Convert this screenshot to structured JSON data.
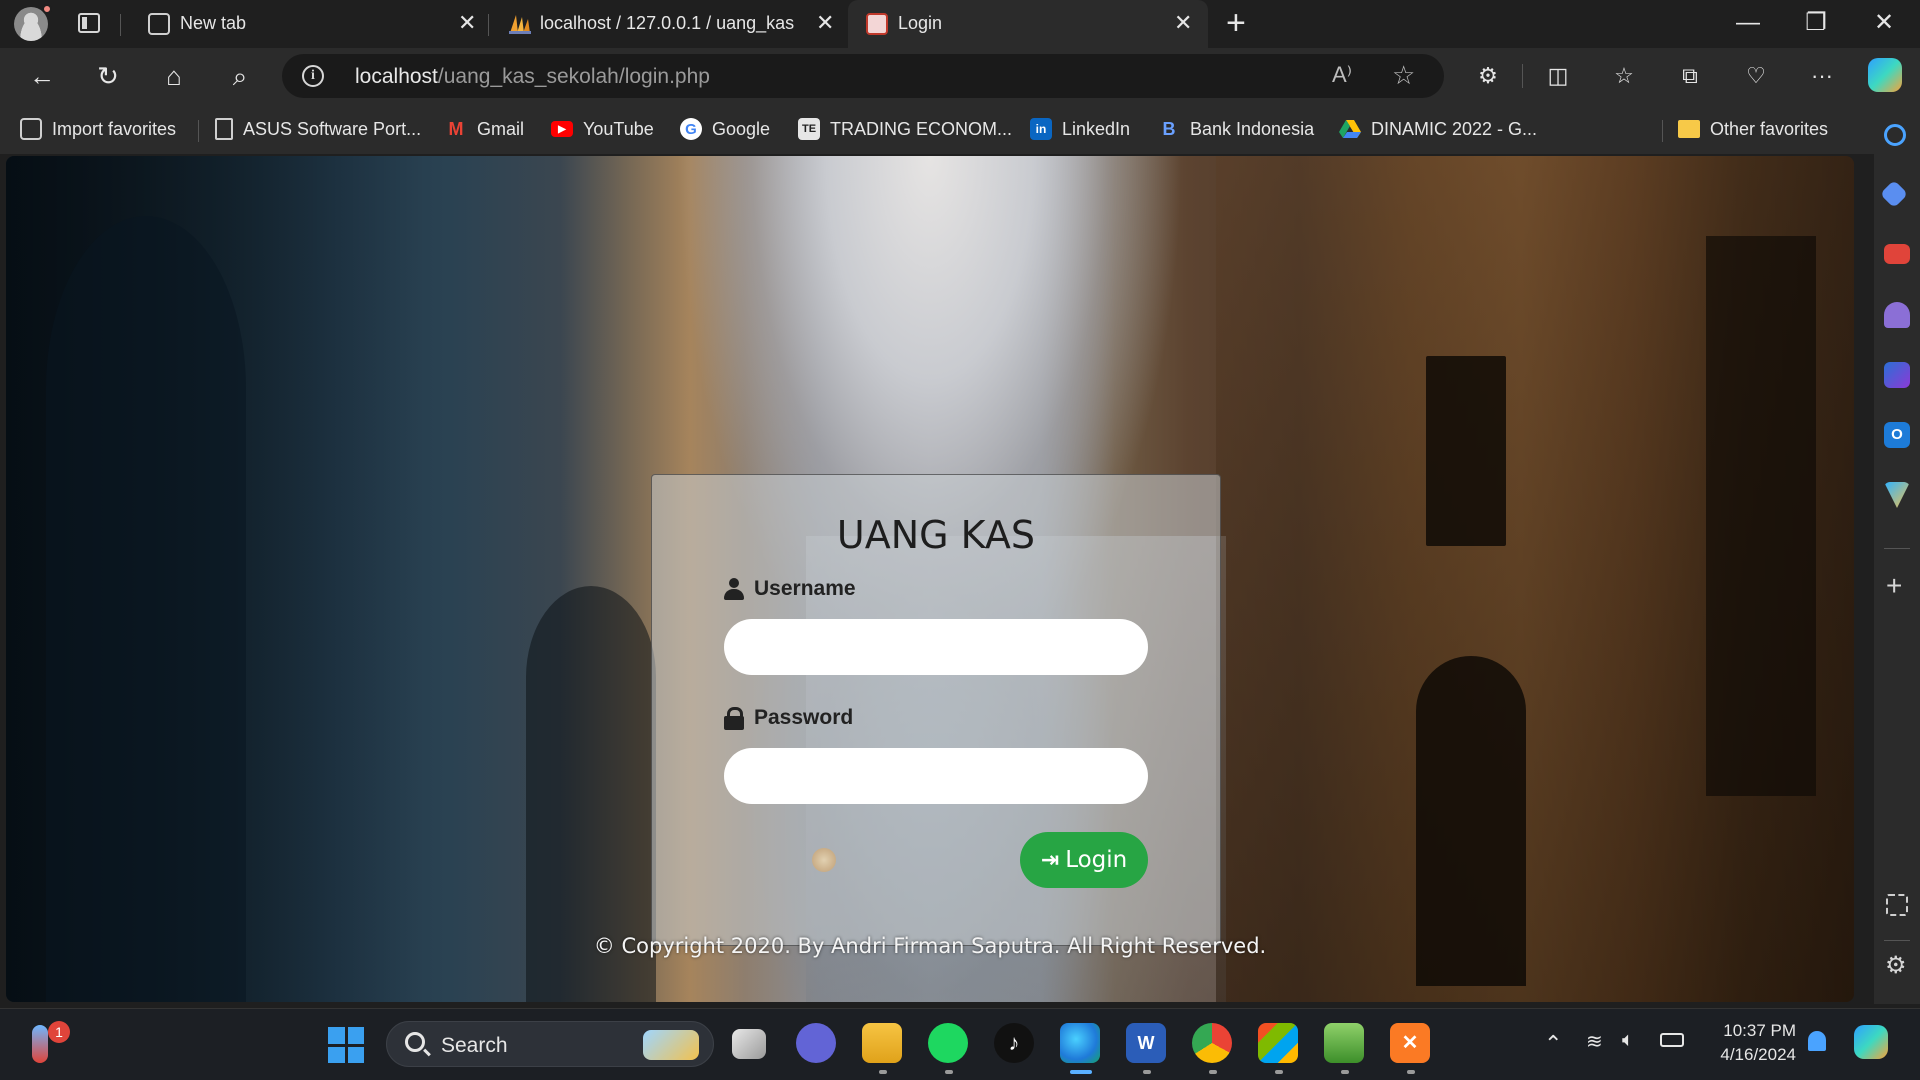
{
  "browser": {
    "tabs": [
      {
        "label": "New tab",
        "icon": "new-tab-page-icon"
      },
      {
        "label": "localhost / 127.0.0.1 / uang_kas /",
        "icon": "phpmyadmin-icon"
      },
      {
        "label": "Login",
        "icon": "site-favicon-icon",
        "active": true
      }
    ],
    "close_glyph": "✕",
    "newtab_glyph": "+",
    "window_controls": {
      "minimize": "—",
      "restore": "❐",
      "close": "✕"
    },
    "address": {
      "host": "localhost",
      "path": "/uang_kas_sekolah/login.php",
      "info_glyph": "i"
    },
    "nav_glyphs": {
      "back": "←",
      "refresh": "↻",
      "home": "⌂",
      "search": "⌕"
    },
    "toolbar_glyphs": {
      "read_aloud": "A⁾",
      "favorite": "☆",
      "more": "···"
    },
    "favorites": [
      {
        "label": "Import favorites",
        "icon": "import-icon"
      },
      {
        "label": "ASUS Software Port...",
        "icon": "page-icon"
      },
      {
        "label": "Gmail",
        "icon": "gmail-icon",
        "color": "#ea4335"
      },
      {
        "label": "YouTube",
        "icon": "youtube-icon",
        "color": "#ff0000"
      },
      {
        "label": "Google",
        "icon": "google-icon",
        "color": "#4285f4"
      },
      {
        "label": "TRADING ECONOM...",
        "icon": "tradingeconomics-icon"
      },
      {
        "label": "LinkedIn",
        "icon": "linkedin-icon",
        "color": "#0a66c2"
      },
      {
        "label": "Bank Indonesia",
        "icon": "bank-indonesia-icon",
        "color": "#1e5bb8"
      },
      {
        "label": "DINAMIC 2022 - G...",
        "icon": "google-drive-icon"
      }
    ],
    "other_favorites": "Other favorites"
  },
  "page": {
    "title": "UANG KAS",
    "username_label": "Username",
    "password_label": "Password",
    "username_value": "",
    "password_value": "",
    "login_button": "Login",
    "login_button_color": "#27a544",
    "copyright": "© Copyright 2020. By Andri Firman Saputra. All Right Reserved."
  },
  "taskbar": {
    "search_label": "Search",
    "notification_badge": "1",
    "time": "10:37 PM",
    "date": "4/16/2024",
    "apps": [
      "start-icon",
      "file-manager-icon",
      "teams-icon",
      "explorer-icon",
      "spotify-icon",
      "tiktok-icon",
      "edge-icon",
      "word-icon",
      "chrome-icon",
      "store-icon",
      "notepad-icon",
      "xampp-icon"
    ]
  }
}
